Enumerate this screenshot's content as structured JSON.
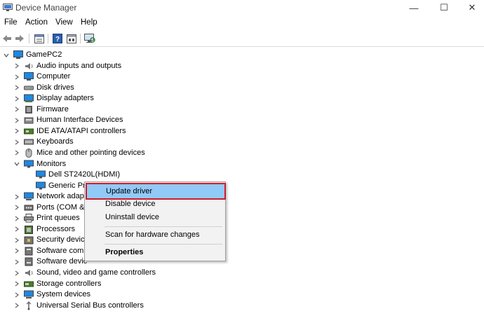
{
  "window": {
    "title": "Device Manager",
    "minimize_glyph": "—",
    "maximize_glyph": "☐",
    "close_glyph": "✕"
  },
  "menubar": {
    "file": "File",
    "action": "Action",
    "view": "View",
    "help": "Help"
  },
  "toolbar": {
    "icons": [
      "back-arrow-icon",
      "forward-arrow-icon",
      "properties-icon",
      "help-icon",
      "details-icon",
      "monitor-scan-icon"
    ]
  },
  "tree": {
    "root": "GamePC2",
    "categories": [
      {
        "label": "Audio inputs and outputs",
        "icon": "speaker-icon"
      },
      {
        "label": "Computer",
        "icon": "computer-icon"
      },
      {
        "label": "Disk drives",
        "icon": "disk-drive-icon"
      },
      {
        "label": "Display adapters",
        "icon": "display-adapter-icon"
      },
      {
        "label": "Firmware",
        "icon": "firmware-chip-icon"
      },
      {
        "label": "Human Interface Devices",
        "icon": "hid-icon"
      },
      {
        "label": "IDE ATA/ATAPI controllers",
        "icon": "ide-controller-icon"
      },
      {
        "label": "Keyboards",
        "icon": "keyboard-icon"
      },
      {
        "label": "Mice and other pointing devices",
        "icon": "mouse-icon"
      },
      {
        "label": "Monitors",
        "icon": "monitor-icon",
        "expanded": true
      },
      {
        "label": "Network adapt",
        "icon": "network-adapter-icon"
      },
      {
        "label": "Ports (COM &",
        "icon": "port-icon"
      },
      {
        "label": "Print queues",
        "icon": "printer-icon"
      },
      {
        "label": "Processors",
        "icon": "processor-icon"
      },
      {
        "label": "Security device",
        "icon": "security-device-icon"
      },
      {
        "label": "Software comp",
        "icon": "software-component-icon"
      },
      {
        "label": "Software devic",
        "icon": "software-device-icon"
      },
      {
        "label": "Sound, video and game controllers",
        "icon": "sound-icon"
      },
      {
        "label": "Storage controllers",
        "icon": "storage-controller-icon"
      },
      {
        "label": "System devices",
        "icon": "system-devices-icon"
      },
      {
        "label": "Universal Serial Bus controllers",
        "icon": "usb-icon"
      }
    ],
    "monitor_children": [
      {
        "label": "Dell ST2420L(HDMI)",
        "icon": "monitor-icon"
      },
      {
        "label": "Generic PnP Monitor",
        "visible_label": "Generic PnP",
        "icon": "monitor-icon"
      }
    ]
  },
  "context_menu": {
    "items": [
      {
        "label": "Update driver",
        "highlighted": true
      },
      {
        "label": "Disable device"
      },
      {
        "label": "Uninstall device"
      },
      {
        "label": "Scan for hardware changes"
      },
      {
        "label": "Properties",
        "bold": true
      }
    ]
  },
  "colors": {
    "highlight_bg": "#91c9f7",
    "highlight_border": "#d11a2a",
    "monitor_blue": "#1e88e5"
  }
}
